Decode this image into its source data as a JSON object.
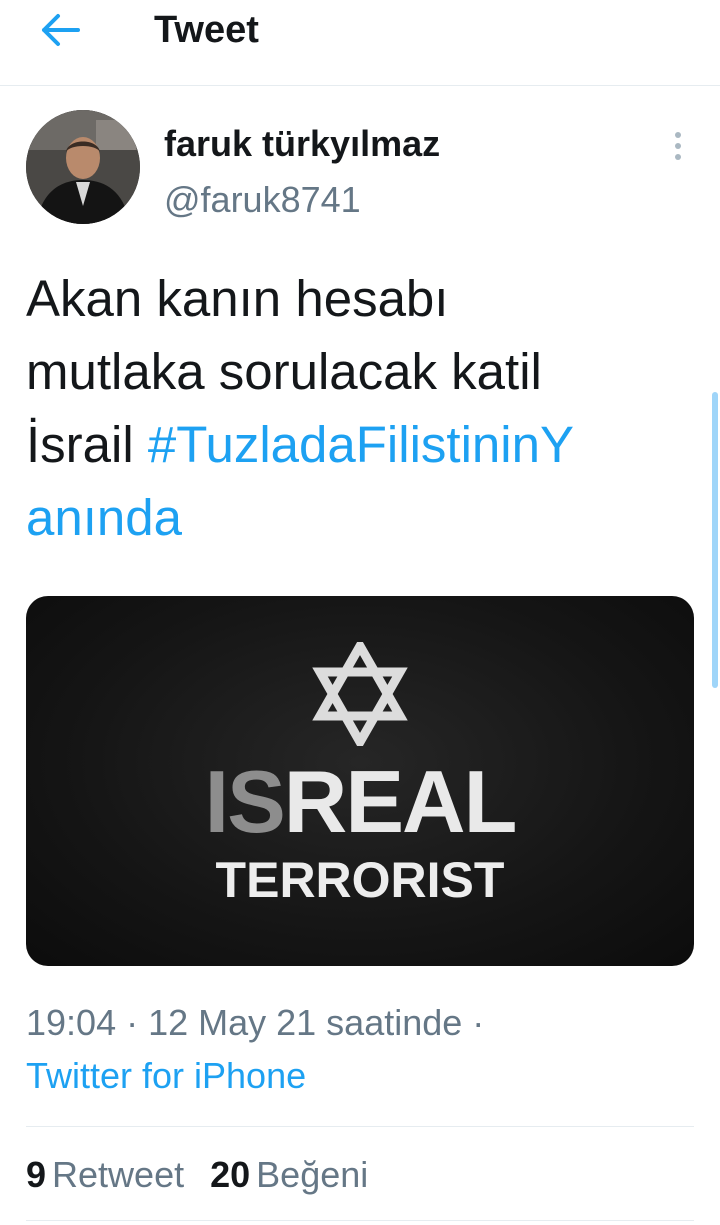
{
  "header": {
    "title": "Tweet",
    "back_icon": "arrow-left-icon"
  },
  "author": {
    "name": "faruk türkyılmaz",
    "handle": "@faruk8741",
    "more_icon": "more-vertical-icon"
  },
  "tweet": {
    "text_lines": [
      "Akan kanın hesabı",
      "mutlaka sorulacak katil",
      "İsrail "
    ],
    "hashtag_line1": "#TuzladaFilistininY",
    "hashtag_line2": "anında"
  },
  "media": {
    "star_icon": "star-of-david-icon",
    "line1_dim": "IS",
    "line1_bright": "REAL",
    "line2": "TERRORIST"
  },
  "meta": {
    "timestamp": "19:04 · 12 May 21 saatinde ·",
    "source": "Twitter for iPhone"
  },
  "stats": {
    "retweets_count": "9",
    "retweets_label": "Retweet",
    "likes_count": "20",
    "likes_label": "Beğeni"
  },
  "colors": {
    "accent": "#1da1f2",
    "secondary_text": "#657786",
    "primary_text": "#14171a",
    "divider": "#e6ecf0"
  }
}
